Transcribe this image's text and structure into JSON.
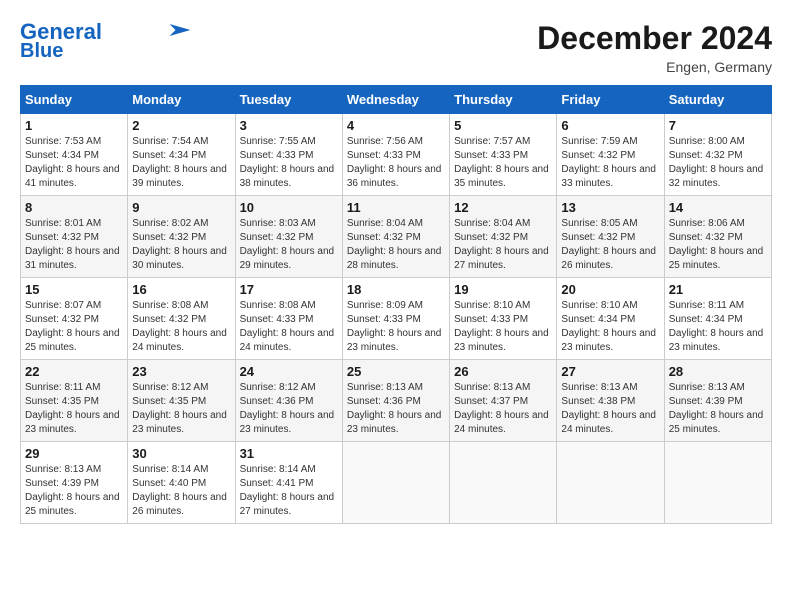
{
  "header": {
    "logo_line1": "General",
    "logo_line2": "Blue",
    "month": "December 2024",
    "location": "Engen, Germany"
  },
  "weekdays": [
    "Sunday",
    "Monday",
    "Tuesday",
    "Wednesday",
    "Thursday",
    "Friday",
    "Saturday"
  ],
  "weeks": [
    [
      {
        "day": "1",
        "sunrise": "7:53 AM",
        "sunset": "4:34 PM",
        "daylight": "8 hours and 41 minutes."
      },
      {
        "day": "2",
        "sunrise": "7:54 AM",
        "sunset": "4:34 PM",
        "daylight": "8 hours and 39 minutes."
      },
      {
        "day": "3",
        "sunrise": "7:55 AM",
        "sunset": "4:33 PM",
        "daylight": "8 hours and 38 minutes."
      },
      {
        "day": "4",
        "sunrise": "7:56 AM",
        "sunset": "4:33 PM",
        "daylight": "8 hours and 36 minutes."
      },
      {
        "day": "5",
        "sunrise": "7:57 AM",
        "sunset": "4:33 PM",
        "daylight": "8 hours and 35 minutes."
      },
      {
        "day": "6",
        "sunrise": "7:59 AM",
        "sunset": "4:32 PM",
        "daylight": "8 hours and 33 minutes."
      },
      {
        "day": "7",
        "sunrise": "8:00 AM",
        "sunset": "4:32 PM",
        "daylight": "8 hours and 32 minutes."
      }
    ],
    [
      {
        "day": "8",
        "sunrise": "8:01 AM",
        "sunset": "4:32 PM",
        "daylight": "8 hours and 31 minutes."
      },
      {
        "day": "9",
        "sunrise": "8:02 AM",
        "sunset": "4:32 PM",
        "daylight": "8 hours and 30 minutes."
      },
      {
        "day": "10",
        "sunrise": "8:03 AM",
        "sunset": "4:32 PM",
        "daylight": "8 hours and 29 minutes."
      },
      {
        "day": "11",
        "sunrise": "8:04 AM",
        "sunset": "4:32 PM",
        "daylight": "8 hours and 28 minutes."
      },
      {
        "day": "12",
        "sunrise": "8:04 AM",
        "sunset": "4:32 PM",
        "daylight": "8 hours and 27 minutes."
      },
      {
        "day": "13",
        "sunrise": "8:05 AM",
        "sunset": "4:32 PM",
        "daylight": "8 hours and 26 minutes."
      },
      {
        "day": "14",
        "sunrise": "8:06 AM",
        "sunset": "4:32 PM",
        "daylight": "8 hours and 25 minutes."
      }
    ],
    [
      {
        "day": "15",
        "sunrise": "8:07 AM",
        "sunset": "4:32 PM",
        "daylight": "8 hours and 25 minutes."
      },
      {
        "day": "16",
        "sunrise": "8:08 AM",
        "sunset": "4:32 PM",
        "daylight": "8 hours and 24 minutes."
      },
      {
        "day": "17",
        "sunrise": "8:08 AM",
        "sunset": "4:33 PM",
        "daylight": "8 hours and 24 minutes."
      },
      {
        "day": "18",
        "sunrise": "8:09 AM",
        "sunset": "4:33 PM",
        "daylight": "8 hours and 23 minutes."
      },
      {
        "day": "19",
        "sunrise": "8:10 AM",
        "sunset": "4:33 PM",
        "daylight": "8 hours and 23 minutes."
      },
      {
        "day": "20",
        "sunrise": "8:10 AM",
        "sunset": "4:34 PM",
        "daylight": "8 hours and 23 minutes."
      },
      {
        "day": "21",
        "sunrise": "8:11 AM",
        "sunset": "4:34 PM",
        "daylight": "8 hours and 23 minutes."
      }
    ],
    [
      {
        "day": "22",
        "sunrise": "8:11 AM",
        "sunset": "4:35 PM",
        "daylight": "8 hours and 23 minutes."
      },
      {
        "day": "23",
        "sunrise": "8:12 AM",
        "sunset": "4:35 PM",
        "daylight": "8 hours and 23 minutes."
      },
      {
        "day": "24",
        "sunrise": "8:12 AM",
        "sunset": "4:36 PM",
        "daylight": "8 hours and 23 minutes."
      },
      {
        "day": "25",
        "sunrise": "8:13 AM",
        "sunset": "4:36 PM",
        "daylight": "8 hours and 23 minutes."
      },
      {
        "day": "26",
        "sunrise": "8:13 AM",
        "sunset": "4:37 PM",
        "daylight": "8 hours and 24 minutes."
      },
      {
        "day": "27",
        "sunrise": "8:13 AM",
        "sunset": "4:38 PM",
        "daylight": "8 hours and 24 minutes."
      },
      {
        "day": "28",
        "sunrise": "8:13 AM",
        "sunset": "4:39 PM",
        "daylight": "8 hours and 25 minutes."
      }
    ],
    [
      {
        "day": "29",
        "sunrise": "8:13 AM",
        "sunset": "4:39 PM",
        "daylight": "8 hours and 25 minutes."
      },
      {
        "day": "30",
        "sunrise": "8:14 AM",
        "sunset": "4:40 PM",
        "daylight": "8 hours and 26 minutes."
      },
      {
        "day": "31",
        "sunrise": "8:14 AM",
        "sunset": "4:41 PM",
        "daylight": "8 hours and 27 minutes."
      },
      null,
      null,
      null,
      null
    ]
  ]
}
